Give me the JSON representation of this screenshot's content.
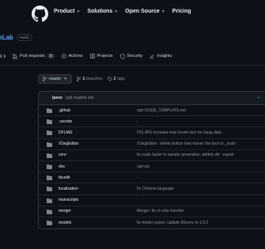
{
  "header": {
    "nav": [
      {
        "label": "Product",
        "dropdown": true
      },
      {
        "label": "Solutions",
        "dropdown": true
      },
      {
        "label": "Open Source",
        "dropdown": true
      },
      {
        "label": "Pricing",
        "dropdown": false
      }
    ]
  },
  "repo": {
    "name": "eLab",
    "visibility": "Public"
  },
  "tabs": [
    {
      "label": "Pull requests",
      "count": "8",
      "icon": "pull-request-icon"
    },
    {
      "label": "Actions",
      "icon": "actions-icon"
    },
    {
      "label": "Projects",
      "icon": "projects-icon"
    },
    {
      "label": "Security",
      "icon": "shield-icon"
    },
    {
      "label": "Insights",
      "icon": "graph-icon"
    }
  ],
  "toolbar": {
    "branch": "master",
    "branches_count": "3",
    "branches_label": "branches",
    "tags_count": "2",
    "tags_label": "tags"
  },
  "latest_commit": {
    "author": "ipevv",
    "message": "upd readme site"
  },
  "files": [
    {
      "name": ".github",
      "message": "upd ISSUE_TEMPLATE.md"
    },
    {
      "name": ".vscode",
      "message": "-"
    },
    {
      "name": "DFLMG",
      "message": "DFLJPG increase max chunk size for wasg data"
    },
    {
      "name": "XSegEditor",
      "message": "XSegEditor : delete button now moves the face to _trash"
    },
    {
      "name": "core",
      "message": "fix scale factor in sample generation. added util - export"
    },
    {
      "name": "doc",
      "message": "upd pic"
    },
    {
      "name": "facelib",
      "message": "-"
    },
    {
      "name": "localization",
      "message": "fix Chinese language"
    },
    {
      "name": "mainscripts",
      "message": "-"
    },
    {
      "name": "merger",
      "message": "Merger: fix ct color transfer"
    },
    {
      "name": "models",
      "message": "fix model export. Update tf2onnx to 1.9.2"
    }
  ],
  "colors": {
    "background": "#0d1117",
    "link": "#58a6ff",
    "border": "#30363d",
    "success": "#3fb950"
  }
}
